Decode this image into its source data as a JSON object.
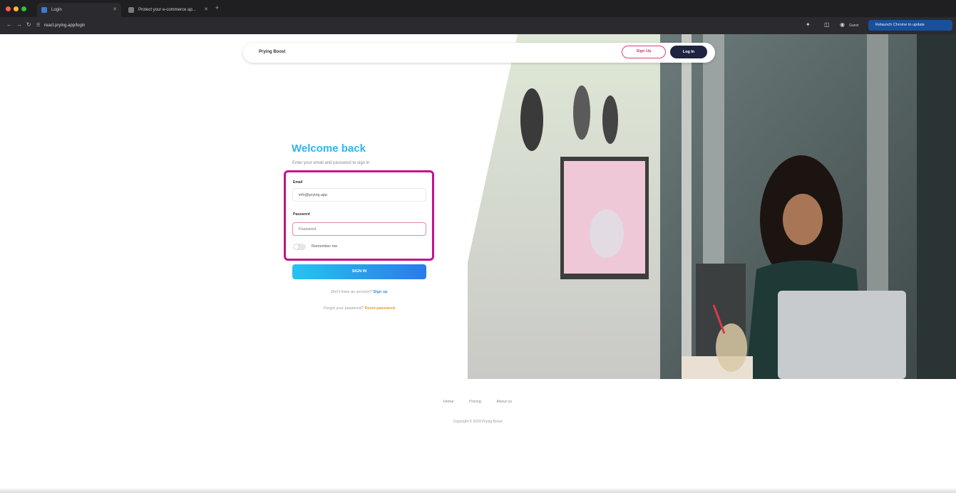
{
  "browser": {
    "tabs": [
      {
        "title": "Login"
      },
      {
        "title": "Protect your e-commerce ap..."
      }
    ],
    "new_tab": "+",
    "url": "react.prying.app/login",
    "toolbar_icons": [
      "extensions-icon",
      "sidebar-icon",
      "profile-icon"
    ],
    "profile_label": "Guest",
    "relaunch_label": "Relaunch Chrome to update"
  },
  "site": {
    "brand": "Prying Boost",
    "nav_signup_label": "Sign Up",
    "nav_login_label": "Log In"
  },
  "form": {
    "title": "Welcome back",
    "subtitle": "Enter your email and password to sign in",
    "email_label": "Email",
    "email_value": "info@prying.app",
    "password_label": "Password",
    "password_placeholder": "Password",
    "remember_label": "Remember me",
    "signin_label": "SIGN IN",
    "signup_prompt": "Don't have an account?",
    "signup_link": "Sign up",
    "forgot_prompt": "Forgot your password?",
    "forgot_link": "Reset password"
  },
  "footer": {
    "links": [
      "Home",
      "Pricing",
      "About us"
    ],
    "copyright": "Copyright © 2024 Prying Boost"
  },
  "colors": {
    "accent": "#2fb6ea",
    "highlight": "#c4128f",
    "dark": "#1d2340"
  }
}
